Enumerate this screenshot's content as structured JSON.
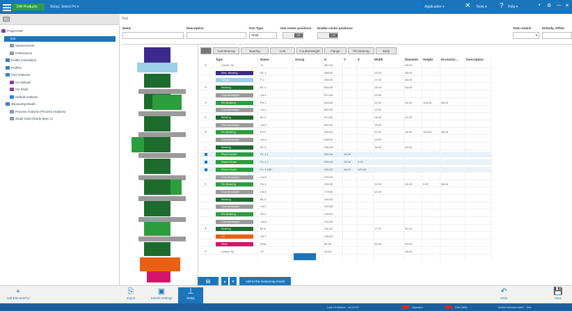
{
  "app": {
    "badge": "DW Products",
    "project_menu": "Setup: Select Prt ▾",
    "user": "Application ▾",
    "tools": "Tools ▾",
    "help": "Help ▾"
  },
  "tree": {
    "items": [
      {
        "label": "Project DW",
        "color": "#8a3fa0"
      },
      {
        "label": "Test",
        "color": "#1b75bb"
      },
      {
        "label": "Measurement",
        "color": "#8899aa"
      },
      {
        "label": "Preferences",
        "color": "#8899aa"
      },
      {
        "label": "Profile Calculation",
        "color": "#3a7dc8"
      },
      {
        "label": "Profiles",
        "color": "#3a7dc8"
      },
      {
        "label": "Part Features",
        "color": "#3a7dc8"
      },
      {
        "label": "UV Default",
        "color": "#8a3fa0"
      },
      {
        "label": "UV Shaft",
        "color": "#8a3fa0"
      },
      {
        "label": "Default Analysis",
        "color": "#3a7dc8"
      },
      {
        "label": "Measuring Model",
        "color": "#3a7dc8"
      },
      {
        "label": "Process Analysis (Process Analysis)",
        "color": "#8899aa"
      },
      {
        "label": "Study Input (Study Spec 1)",
        "color": "#8899aa"
      }
    ]
  },
  "form": {
    "title": "Test",
    "labels": [
      "Name",
      "Description",
      "Part Type",
      "Use center positions",
      "Enable center positions",
      "Task routine",
      "E/Study, Offset"
    ],
    "part_type_value": "Shaft",
    "toggle_a": "Off",
    "toggle_b": "Off"
  },
  "tabs": [
    "Axis Bearing",
    "Bearing",
    "Link",
    "Counterweight",
    "Flange",
    "Pin Bearing",
    "Body"
  ],
  "grid": {
    "headers": [
      "Type",
      "Name",
      "Group",
      "X",
      "Y",
      "Z",
      "Width",
      "Diameter",
      "Height",
      "Eccentric...",
      "Description"
    ],
    "rows": [
      {
        "mark": "+",
        "type": "Center Tip",
        "chip": "",
        "name": "T1",
        "x": "387.00",
        "y": "",
        "z": "",
        "w": "",
        "d": "28.00",
        "h": "",
        "e": ""
      },
      {
        "mark": "",
        "type": "Max. Bearing",
        "chip": "#3b2a8c",
        "name": "B1.1",
        "x": "368.00",
        "y": "",
        "z": "",
        "w": "14.00",
        "d": "38.00",
        "h": "",
        "e": ""
      },
      {
        "mark": "",
        "type": "Flange",
        "chip": "#9ad0e8",
        "name": "F.1",
        "x": "350.00",
        "y": "",
        "z": "",
        "w": "17.00",
        "d": "46.00",
        "h": "",
        "e": ""
      },
      {
        "mark": "+",
        "type": "Bearing",
        "chip": "#1e6b2e",
        "name": "B1.2",
        "x": "684.00",
        "y": "",
        "z": "",
        "w": "18.00",
        "d": "32.00",
        "h": "",
        "e": ""
      },
      {
        "mark": "",
        "type": "Counterweight",
        "chip": "#9a9a9a",
        "name": "Cw.1",
        "x": "670.00",
        "y": "",
        "z": "",
        "w": "13.00",
        "d": "",
        "h": "",
        "e": ""
      },
      {
        "mark": "+",
        "type": "Pin Bearing",
        "chip": "#2c9d3c",
        "name": "Pb.1",
        "x": "646.00",
        "y": "",
        "z": "",
        "w": "12.00",
        "d": "34.00",
        "h": "128.00",
        "e": "38.00"
      },
      {
        "mark": "",
        "type": "Counterweight",
        "chip": "#9a9a9a",
        "name": "Cw.2",
        "x": "960.00",
        "y": "",
        "z": "",
        "w": "13.00",
        "d": "",
        "h": "",
        "e": ""
      },
      {
        "mark": "+",
        "type": "Bearing",
        "chip": "#1e6b2e",
        "name": "B1.3",
        "x": "574.00",
        "y": "",
        "z": "",
        "w": "18.00",
        "d": "32.00",
        "h": "",
        "e": ""
      },
      {
        "mark": "",
        "type": "Counterweight",
        "chip": "#9a9a9a",
        "name": "Cw.3",
        "x": "560.00",
        "y": "",
        "z": "",
        "w": "13.00",
        "d": "",
        "h": "",
        "e": ""
      },
      {
        "mark": "+",
        "type": "Pin Bearing",
        "chip": "#2c9d3c",
        "name": "Pb.2",
        "x": "300.00",
        "y": "",
        "z": "",
        "w": "12.00",
        "d": "34.00",
        "h": "128.00",
        "e": "38.00"
      },
      {
        "mark": "",
        "type": "Counterweight",
        "chip": "#9a9a9a",
        "name": "Cw.4",
        "x": "288.00",
        "y": "",
        "z": "",
        "w": "13.00",
        "d": "",
        "h": "",
        "e": ""
      },
      {
        "mark": "−",
        "type": "Bearing",
        "chip": "#1e6b2e",
        "name": "B1.4",
        "x": "280.00",
        "y": "",
        "z": "",
        "w": "18.00",
        "d": "32.00",
        "h": "",
        "e": ""
      },
      {
        "mark": "sq",
        "type": "Plane Model",
        "chip": "#2c9d3c",
        "name": "PL.1.1",
        "x": "280.00",
        "y": "18.00",
        "z": "",
        "w": "",
        "d": "",
        "h": "",
        "e": "",
        "hl": true
      },
      {
        "mark": "sq",
        "type": "Plane Model",
        "chip": "#2c9d3c",
        "name": "PL.1.2",
        "x": "260.00",
        "y": "18.00",
        "z": "9.00",
        "w": "",
        "d": "",
        "h": "",
        "e": "",
        "hl": true
      },
      {
        "mark": "sq",
        "type": "Plane Model",
        "chip": "#2c9d3c",
        "name": "PL.1.180°",
        "x": "240.00",
        "y": "18.00",
        "z": "120.00",
        "w": "",
        "d": "",
        "h": "",
        "e": "",
        "hl": true
      },
      {
        "mark": "",
        "type": "Counterweight",
        "chip": "#9a9a9a",
        "name": "Cw.5",
        "x": "220.00",
        "y": "",
        "z": "",
        "w": "",
        "d": "",
        "h": "",
        "e": ""
      },
      {
        "mark": "+",
        "type": "Pin Bearing",
        "chip": "#2c9d3c",
        "name": "Pb.3",
        "x": "200.00",
        "y": "",
        "z": "",
        "w": "12.00",
        "d": "34.00",
        "h": "9.00",
        "e": "38.00"
      },
      {
        "mark": "",
        "type": "Counterweight",
        "chip": "#9a9a9a",
        "name": "Cw.6",
        "x": "178.00",
        "y": "",
        "z": "",
        "w": "12.00",
        "d": "",
        "h": "",
        "e": ""
      },
      {
        "mark": "",
        "type": "Bearing",
        "chip": "#1e6b2e",
        "name": "B1.5",
        "x": "160.00",
        "y": "",
        "z": "",
        "w": "",
        "d": "",
        "h": "",
        "e": ""
      },
      {
        "mark": "",
        "type": "Counterweight",
        "chip": "#9a9a9a",
        "name": "Cw.7",
        "x": "150.00",
        "y": "",
        "z": "",
        "w": "",
        "d": "",
        "h": "",
        "e": ""
      },
      {
        "mark": "",
        "type": "Pin Bearing",
        "chip": "#2c9d3c",
        "name": "Pb.4",
        "x": "140.00",
        "y": "",
        "z": "",
        "w": "",
        "d": "",
        "h": "",
        "e": ""
      },
      {
        "mark": "",
        "type": "Counterweight",
        "chip": "#9a9a9a",
        "name": "Cw.8",
        "x": "120.00",
        "y": "",
        "z": "",
        "w": "",
        "d": "",
        "h": "",
        "e": ""
      },
      {
        "mark": "+",
        "type": "Bearing",
        "chip": "#1e6b2e",
        "name": "B1.6",
        "x": "110.00",
        "y": "",
        "z": "",
        "w": "17.00",
        "d": "32.00",
        "h": "",
        "e": ""
      },
      {
        "mark": "",
        "type": "Oil",
        "chip": "#e86010",
        "name": "Oil.1",
        "x": "100.00",
        "y": "",
        "z": "",
        "w": "",
        "d": "",
        "h": "",
        "e": ""
      },
      {
        "mark": "",
        "type": "Rear",
        "chip": "#d4146a",
        "name": "Rear",
        "x": "80.00",
        "y": "",
        "z": "",
        "w": "44.00",
        "d": "52.00",
        "h": "",
        "e": ""
      },
      {
        "mark": "+",
        "type": "Center Tip",
        "chip": "",
        "name": "T2",
        "x": "18.00",
        "y": "",
        "z": "",
        "w": "",
        "d": "28.00",
        "h": "",
        "e": ""
      }
    ]
  },
  "bottom_controls": {
    "flag_label": "",
    "action_label": "Add to the measuring model"
  },
  "toolbar": {
    "items": [
      {
        "icon": "+",
        "label": "Add Element/Tpl"
      },
      {
        "icon": "⎘",
        "label": "Import"
      },
      {
        "icon": "▣",
        "label": "Submit settings"
      },
      {
        "icon": "⊥",
        "label": "Setup"
      },
      {
        "icon": "↶",
        "label": "Undo"
      },
      {
        "icon": "💾",
        "label": "Save"
      }
    ]
  },
  "statusbar": {
    "left": "Last 10 Alarms · 16:44:42 ·",
    "mid1": "Operator",
    "mid2": "Part Valid",
    "right": "Active Measurement · Test"
  },
  "diagram": {
    "segments": [
      {
        "kind": "center-tip",
        "color": "#3b2a8c"
      },
      {
        "kind": "flange",
        "color": "#9ad0e8"
      },
      {
        "kind": "bearing",
        "color": "#1e6b2e"
      },
      {
        "kind": "counterweight",
        "color": "#9a9a9a"
      },
      {
        "kind": "pin-bearing",
        "color": "#2c9d3c"
      },
      {
        "kind": "oil",
        "color": "#e86010"
      },
      {
        "kind": "rear",
        "color": "#d4146a"
      }
    ]
  }
}
